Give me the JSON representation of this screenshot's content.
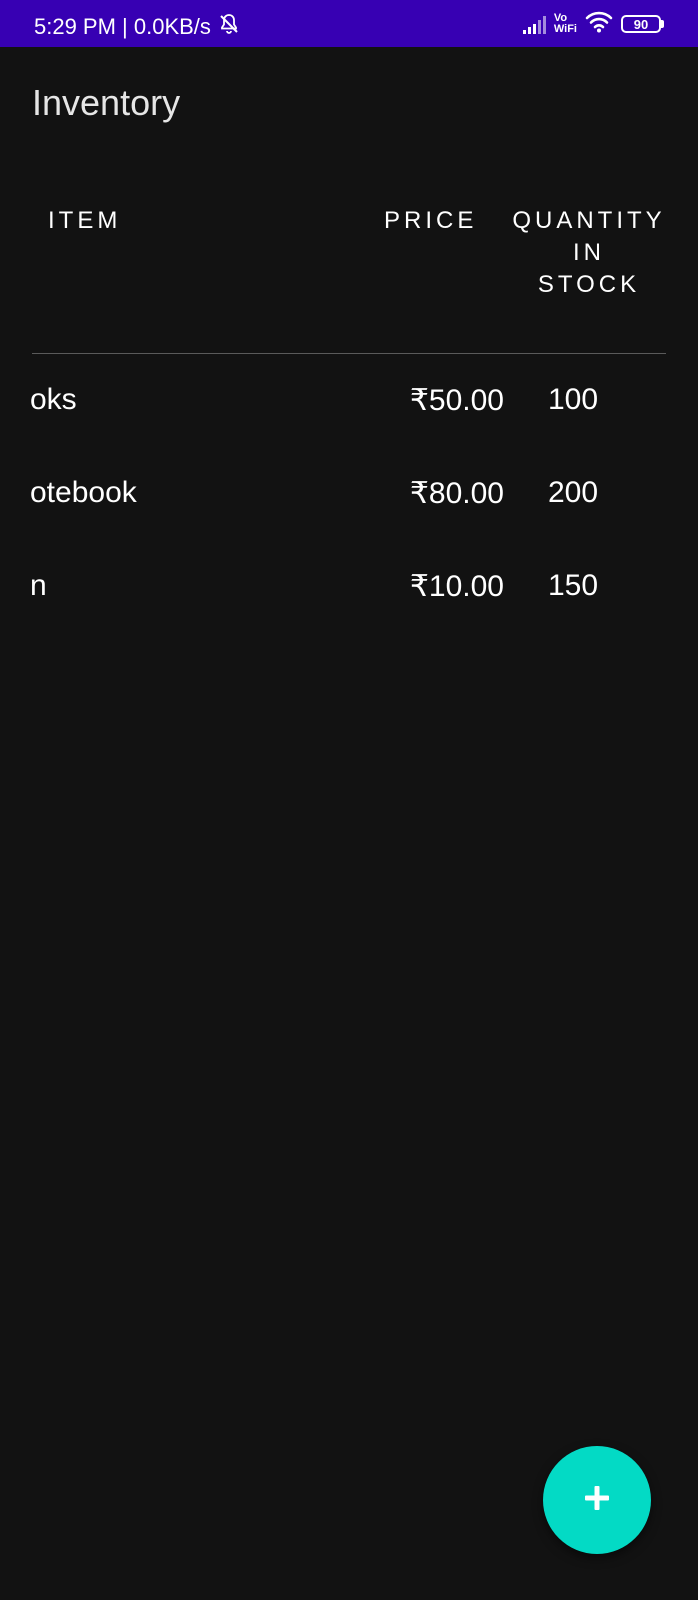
{
  "status_bar": {
    "time_and_speed": "5:29 PM | 0.0KB/s",
    "vowifi_top": "Vo",
    "vowifi_bottom": "WiFi",
    "battery_level": "90"
  },
  "app": {
    "title": "Inventory"
  },
  "table": {
    "headers": {
      "item": "ITEM",
      "price": "PRICE",
      "quantity": "QUANTITY\nIN\nSTOCK"
    },
    "rows": [
      {
        "item": "Books",
        "item_visible": "oks",
        "price": "₹50.00",
        "quantity": "100"
      },
      {
        "item": "Notebook",
        "item_visible": "otebook",
        "price": "₹80.00",
        "quantity": "200"
      },
      {
        "item": "Pen",
        "item_visible": "n",
        "price": "₹10.00",
        "quantity": "150"
      }
    ]
  },
  "fab": {
    "icon": "plus-icon",
    "color": "#03dac5"
  },
  "colors": {
    "status_bar": "#3700b3",
    "background": "#121212",
    "accent": "#03dac5"
  }
}
